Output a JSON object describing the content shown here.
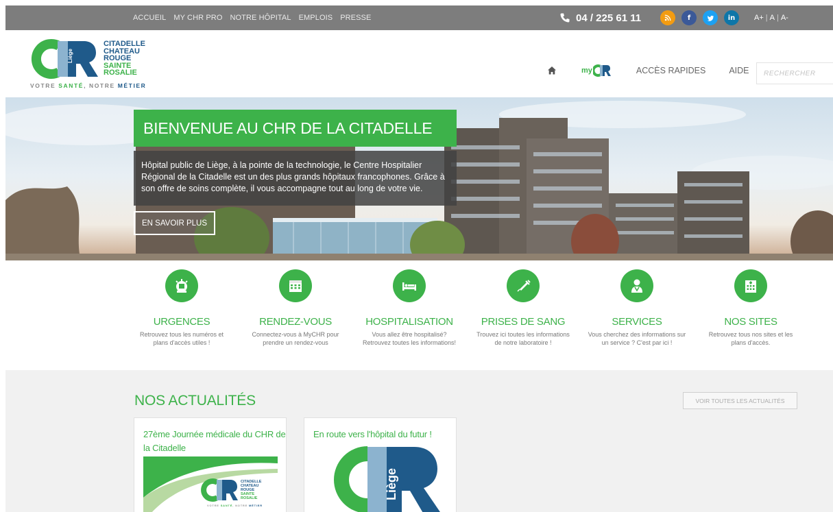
{
  "topbar": {
    "nav": [
      "ACCUEIL",
      "MY CHR PRO",
      "NOTRE HÔPITAL",
      "EMPLOIS",
      "PRESSE"
    ],
    "phone": "04 / 225 61 11",
    "social": [
      {
        "name": "rss-icon",
        "label": "a",
        "color": "#f39c12"
      },
      {
        "name": "facebook-icon",
        "label": "f",
        "color": "#3b5998"
      },
      {
        "name": "twitter-icon",
        "label": "t",
        "color": "#1da1f2"
      },
      {
        "name": "linkedin-icon",
        "label": "in",
        "color": "#0e76a8"
      }
    ],
    "font_controls": [
      "A+",
      "A",
      "A-"
    ]
  },
  "header": {
    "brand_lines": [
      "CITADELLE",
      "CHATEAU",
      "ROUGE",
      "SAINTE",
      "ROSALIE"
    ],
    "tagline_prefix": "VOTRE ",
    "tagline_green": "SANTÉ",
    "tagline_mid": ", NOTRE ",
    "tagline_blue": "MÉTIER",
    "logo_vertical": "Liège",
    "mychr_prefix": "my",
    "nav_acces": "ACCÈS RAPIDES",
    "nav_aide": "AIDE",
    "search_placeholder": "RECHERCHER"
  },
  "hero": {
    "title": "BIENVENUE AU CHR DE LA CITADELLE",
    "text": "Hôpital public de Liège, à la pointe de la technologie, le Centre Hospitalier Régional de la Citadelle est un des plus grands hôpitaux francophones. Grâce à son offre de soins complète, il vous accompagne tout au long de votre vie.",
    "button": "EN SAVOIR PLUS"
  },
  "quick_access": [
    {
      "title": "URGENCES",
      "desc": "Retrouvez tous les numéros et plans d'accès utiles !"
    },
    {
      "title": "RENDEZ-VOUS",
      "desc": "Connectez-vous à MyCHR pour prendre un rendez-vous"
    },
    {
      "title": "HOSPITALISATION",
      "desc": "Vous allez être hospitalisé? Retrouvez toutes les informations!"
    },
    {
      "title": "PRISES DE SANG",
      "desc": "Trouvez ici toutes les informations de notre laboratoire !"
    },
    {
      "title": "SERVICES",
      "desc": "Vous cherchez des informations sur un service ? C'est par ici !"
    },
    {
      "title": "NOS SITES",
      "desc": "Retrouvez tous nos sites et les plans d'accès."
    }
  ],
  "news": {
    "title": "NOS ACTUALITÉS",
    "all_button": "VOIR TOUTES LES ACTUALITÉS",
    "cards": [
      {
        "title": "27ème Journée médicale du CHR de la Citadelle"
      },
      {
        "title": "En route vers l'hôpital du futur !"
      }
    ]
  },
  "colors": {
    "green": "#3db24a",
    "blue": "#1f5a8a",
    "topbar": "#7d7d7d"
  }
}
